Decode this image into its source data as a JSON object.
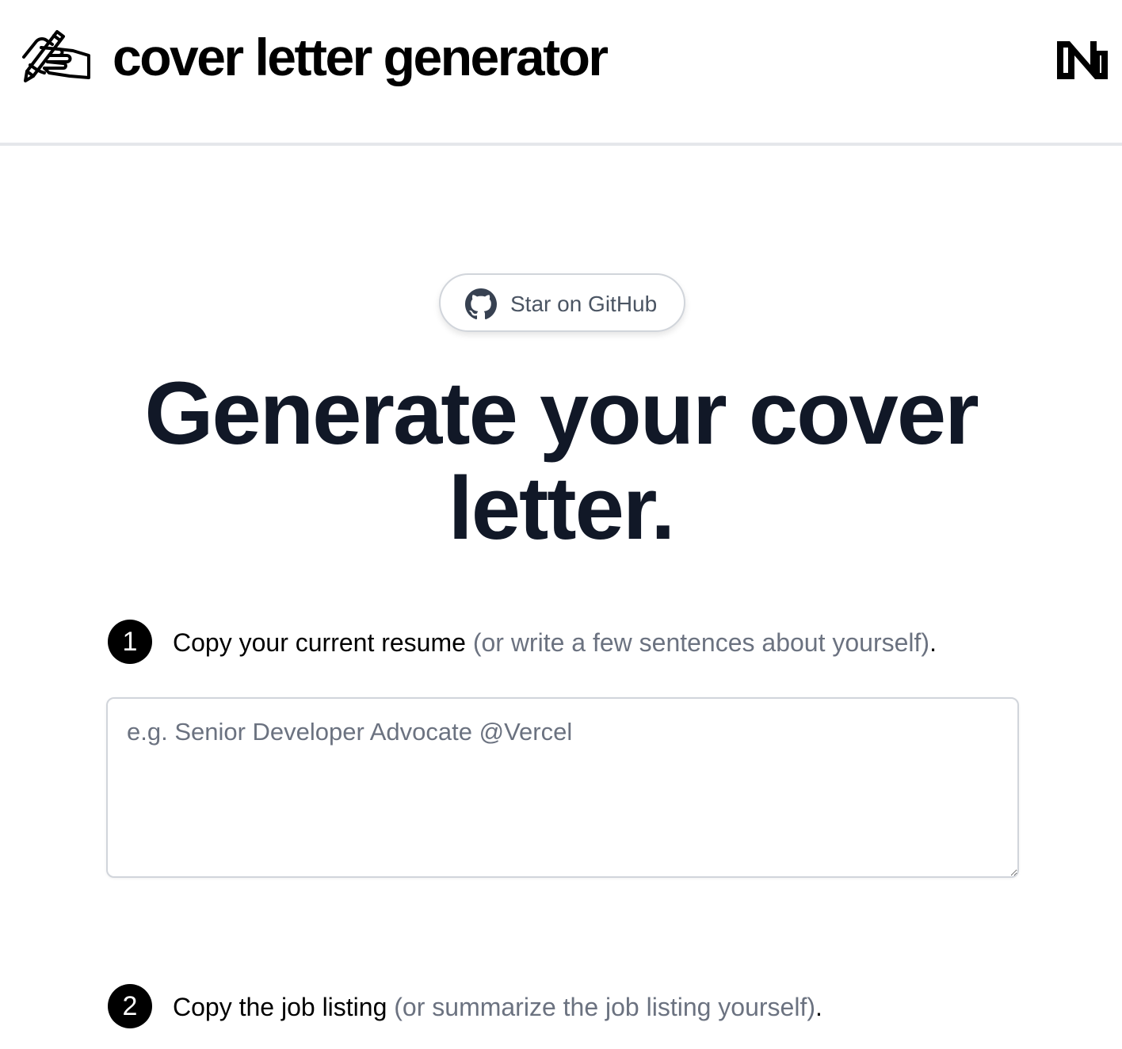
{
  "header": {
    "logo_icon": "writing-hand-icon",
    "title": "cover letter generator",
    "brand_icon": "n-logo-icon"
  },
  "github_button": {
    "icon": "github-icon",
    "label": "Star on GitHub"
  },
  "hero": {
    "line1": "Generate your cover",
    "line2": "letter."
  },
  "steps": [
    {
      "number": "1",
      "strong": "Copy your current resume",
      "muted": "(or write a few sentences about yourself)",
      "end": "."
    },
    {
      "number": "2",
      "strong": "Copy the job listing",
      "muted": "(or summarize the job listing yourself)",
      "end": "."
    }
  ],
  "resume_input": {
    "placeholder": "e.g. Senior Developer Advocate @Vercel",
    "value": ""
  },
  "colors": {
    "heading": "#111827",
    "muted_text": "#6b7280",
    "border": "#d1d5db",
    "badge": "#000000"
  }
}
